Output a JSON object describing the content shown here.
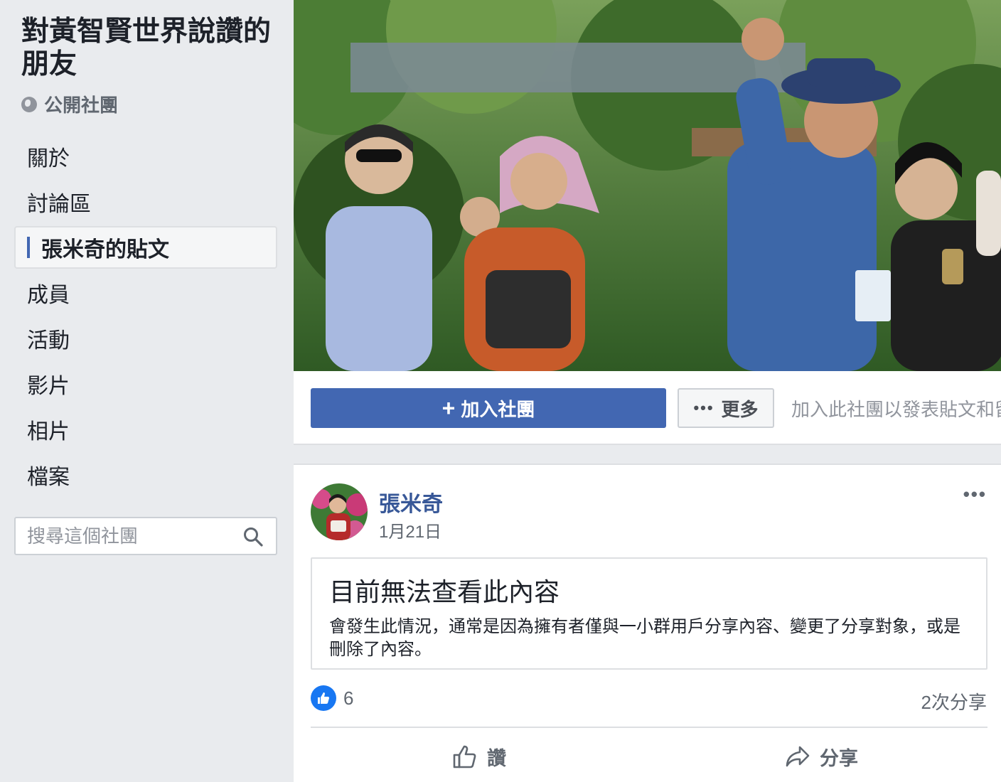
{
  "group": {
    "title": "對黃智賢世界說讚的朋友",
    "privacy": "公開社團"
  },
  "nav": {
    "items": [
      {
        "label": "關於"
      },
      {
        "label": "討論區"
      },
      {
        "label": "張米奇的貼文",
        "active": true
      },
      {
        "label": "成員"
      },
      {
        "label": "活動"
      },
      {
        "label": "影片"
      },
      {
        "label": "相片"
      },
      {
        "label": "檔案"
      }
    ]
  },
  "search": {
    "placeholder": "搜尋這個社團",
    "icon": "search-icon"
  },
  "header": {
    "join_label": "加入社團",
    "more_label": "更多",
    "join_hint": "加入此社團以發表貼文和留言。"
  },
  "post": {
    "author": "張米奇",
    "date": "1月21日",
    "unavailable_title": "目前無法查看此內容",
    "unavailable_body": "會發生此情況，通常是因為擁有者僅與一小群用戶分享內容、變更了分享對象，或是刪除了內容。",
    "like_count": "6",
    "shares": "2次分享",
    "like_action": "讚",
    "share_action": "分享"
  },
  "colors": {
    "brand": "#4267b2",
    "link": "#385898",
    "background": "#e9ebee"
  }
}
